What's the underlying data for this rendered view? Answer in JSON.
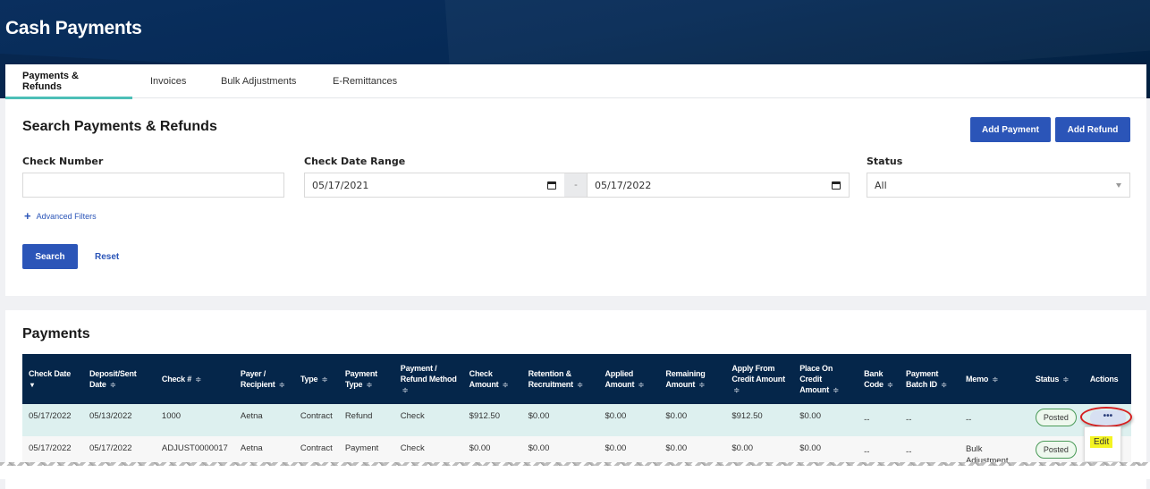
{
  "app": {
    "title": "Cash Payments"
  },
  "tabs": [
    {
      "label": "Payments & Refunds",
      "active": true
    },
    {
      "label": "Invoices",
      "active": false
    },
    {
      "label": "Bulk Adjustments",
      "active": false
    },
    {
      "label": "E-Remittances",
      "active": false
    }
  ],
  "search": {
    "heading": "Search Payments & Refunds",
    "add_payment_label": "Add Payment",
    "add_refund_label": "Add Refund",
    "check_number": {
      "label": "Check Number",
      "value": ""
    },
    "check_date_range": {
      "label": "Check Date Range",
      "from": "05/17/2021",
      "separator": "-",
      "to": "05/17/2022"
    },
    "status": {
      "label": "Status",
      "selected": "All"
    },
    "advanced_filters_label": "Advanced Filters",
    "search_label": "Search",
    "reset_label": "Reset"
  },
  "payments": {
    "heading": "Payments",
    "sort_glyph": "≑",
    "sort_desc_glyph": "▾",
    "columns": [
      {
        "key": "check_date",
        "label": "Check Date",
        "sort": "desc"
      },
      {
        "key": "deposit_date",
        "label": "Deposit/Sent Date",
        "sort": "both"
      },
      {
        "key": "check_no",
        "label": "Check #",
        "sort": "both"
      },
      {
        "key": "payer",
        "label": "Payer / Recipient",
        "sort": "both"
      },
      {
        "key": "type",
        "label": "Type",
        "sort": "both"
      },
      {
        "key": "payment_type",
        "label": "Payment Type",
        "sort": "both"
      },
      {
        "key": "method",
        "label": "Payment / Refund Method",
        "sort": "both"
      },
      {
        "key": "check_amount",
        "label": "Check Amount",
        "sort": "both"
      },
      {
        "key": "retention",
        "label": "Retention & Recruitment",
        "sort": "both"
      },
      {
        "key": "applied",
        "label": "Applied Amount",
        "sort": "both"
      },
      {
        "key": "remaining",
        "label": "Remaining Amount",
        "sort": "both"
      },
      {
        "key": "apply_credit",
        "label": "Apply From Credit Amount",
        "sort": "both"
      },
      {
        "key": "place_credit",
        "label": "Place On Credit Amount",
        "sort": "both"
      },
      {
        "key": "bank_code",
        "label": "Bank Code",
        "sort": "both"
      },
      {
        "key": "batch_id",
        "label": "Payment Batch ID",
        "sort": "both"
      },
      {
        "key": "memo",
        "label": "Memo",
        "sort": "both"
      },
      {
        "key": "status",
        "label": "Status",
        "sort": "both"
      },
      {
        "key": "actions",
        "label": "Actions",
        "sort": "none"
      }
    ],
    "rows": [
      {
        "check_date": "05/17/2022",
        "deposit_date": "05/13/2022",
        "check_no": "1000",
        "payer": "Aetna",
        "type": "Contract",
        "payment_type": "Refund",
        "method": "Check",
        "check_amount": "$912.50",
        "retention": "$0.00",
        "applied": "$0.00",
        "remaining": "$0.00",
        "apply_credit": "$912.50",
        "place_credit": "$0.00",
        "bank_code": "--",
        "batch_id": "--",
        "memo": "--",
        "status": "Posted",
        "actions": "•••"
      },
      {
        "check_date": "05/17/2022",
        "deposit_date": "05/17/2022",
        "check_no": "ADJUST0000017",
        "payer": "Aetna",
        "type": "Contract",
        "payment_type": "Payment",
        "method": "Check",
        "check_amount": "$0.00",
        "retention": "$0.00",
        "applied": "$0.00",
        "remaining": "$0.00",
        "apply_credit": "$0.00",
        "place_credit": "$0.00",
        "bank_code": "--",
        "batch_id": "--",
        "memo": "Bulk Adjustment Check",
        "status": "Posted",
        "actions": ""
      }
    ],
    "row_menu": {
      "items": [
        {
          "label": "Edit"
        }
      ]
    }
  },
  "colors": {
    "brand_blue": "#2b55b8",
    "header_navy": "#05264a",
    "active_tab_accent": "#4dbfb7",
    "posted_badge_border": "#4a9a58",
    "highlight_ring": "#d62020",
    "edit_highlight": "#f4f421"
  }
}
